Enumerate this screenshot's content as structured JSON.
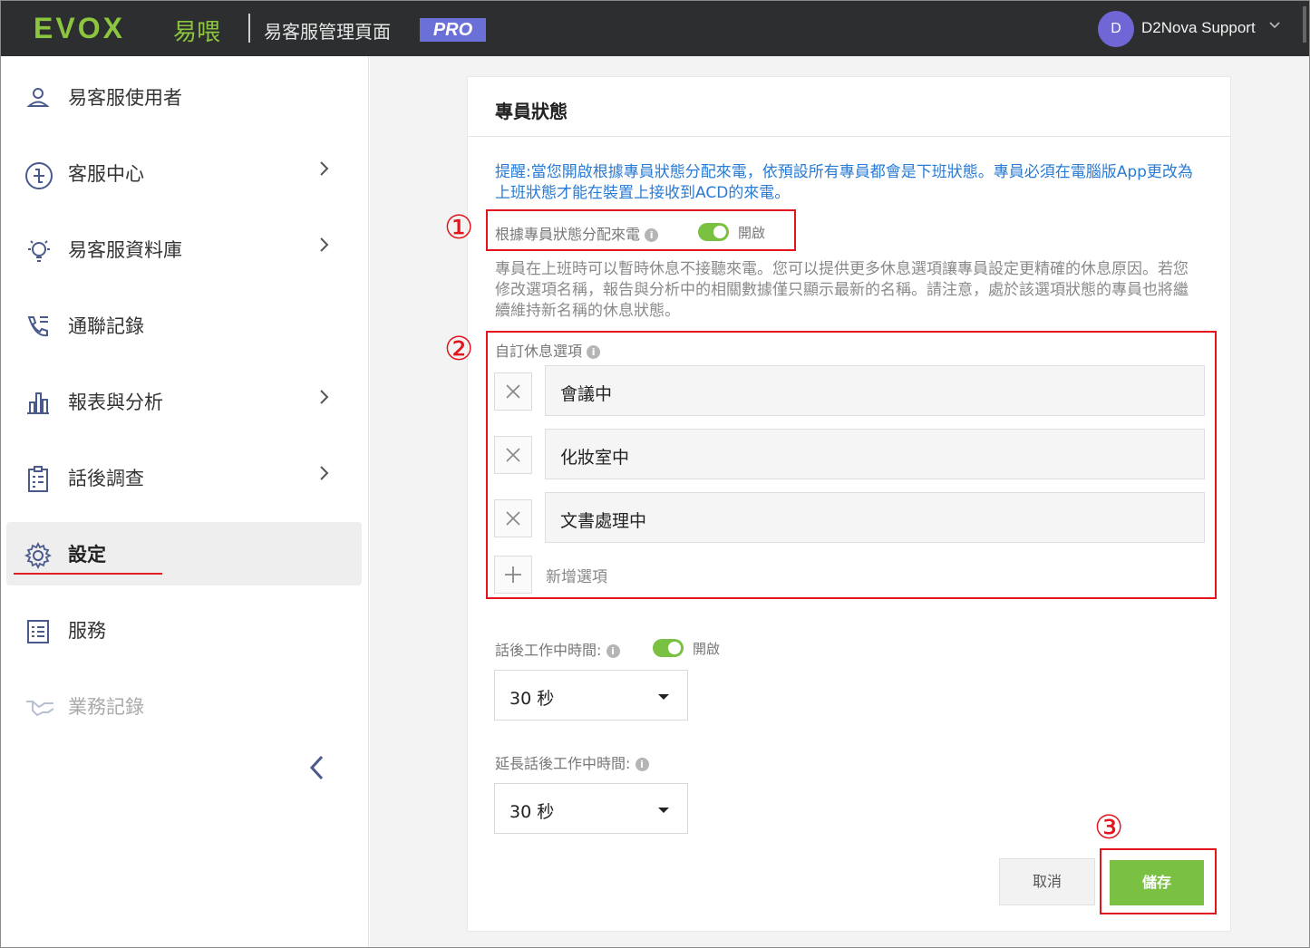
{
  "topbar": {
    "logo": "EVOX",
    "logo_cn": "易喂",
    "app_title": "易客服管理頁面",
    "badge": "PRO",
    "avatar_initial": "D",
    "user_name": "D2Nova Support"
  },
  "sidebar": {
    "items": [
      {
        "label": "易客服使用者",
        "icon": "user-icon",
        "has_chevron": false
      },
      {
        "label": "客服中心",
        "icon": "call-center-icon",
        "has_chevron": true
      },
      {
        "label": "易客服資料庫",
        "icon": "lightbulb-icon",
        "has_chevron": true
      },
      {
        "label": "通聯記錄",
        "icon": "phone-log-icon",
        "has_chevron": false
      },
      {
        "label": "報表與分析",
        "icon": "bar-chart-icon",
        "has_chevron": true
      },
      {
        "label": "話後調查",
        "icon": "clipboard-icon",
        "has_chevron": true
      },
      {
        "label": "設定",
        "icon": "gear-icon",
        "has_chevron": false,
        "active": true
      },
      {
        "label": "服務",
        "icon": "list-icon",
        "has_chevron": false
      },
      {
        "label": "業務記錄",
        "icon": "handshake-icon",
        "has_chevron": false,
        "disabled": true
      }
    ]
  },
  "card": {
    "title": "專員狀態",
    "notice": "提醒:當您開啟根據專員狀態分配來電，依預設所有專員都會是下班狀態。專員必須在電腦版App更改為上班狀態才能在裝置上接收到ACD的來電。",
    "assign_label": "根據專員狀態分配來電",
    "assign_state": "開啟",
    "description": "專員在上班時可以暫時休息不接聽來電。您可以提供更多休息選項讓專員設定更精確的休息原因。若您修改選項名稱，報告與分析中的相關數據僅只顯示最新的名稱。請注意，處於該選項狀態的專員也將繼續維持新名稱的休息狀態。",
    "custom_label": "自訂休息選項",
    "options": [
      "會議中",
      "化妝室中",
      "文書處理中"
    ],
    "add_label": "新增選項",
    "acw_label": "話後工作中時間:",
    "acw_state": "開啟",
    "acw_value": "30 秒",
    "ext_label": "延長話後工作中時間:",
    "ext_value": "30 秒",
    "cancel_label": "取消",
    "save_label": "儲存"
  },
  "annotations": [
    "①",
    "②",
    "③"
  ],
  "colors": {
    "accent_green": "#7ac143",
    "notice_blue": "#2a7bd4",
    "annotation_red": "#e3141b",
    "badge_purple": "#6b6fd8"
  }
}
